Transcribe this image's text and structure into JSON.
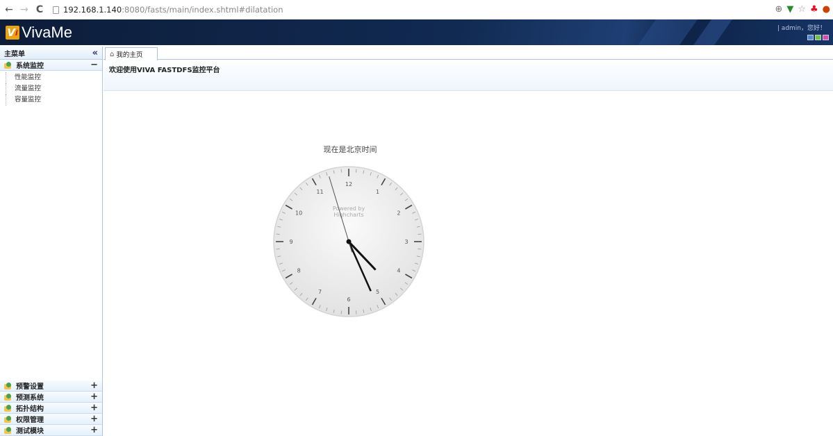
{
  "browser": {
    "url_host": "192.168.1.140",
    "url_path": ":8080/fasts/main/index.shtml#dilatation"
  },
  "header": {
    "logo_mark": "V",
    "logo_dot": "i",
    "app_name": "VivaMe",
    "user_info": "| admin，您好！",
    "theme_colors": [
      "#4a8cd8",
      "#6cc24a",
      "#d84ab8"
    ]
  },
  "sidebar": {
    "title": "主菜单",
    "collapse": "«",
    "groups": [
      {
        "label": "系统监控",
        "toggle": "−",
        "items": [
          "性能监控",
          "流量监控",
          "容量监控"
        ]
      },
      {
        "label": "预警设置",
        "toggle": "+"
      },
      {
        "label": "预测系统",
        "toggle": "+"
      },
      {
        "label": "拓扑结构",
        "toggle": "+"
      },
      {
        "label": "权限管理",
        "toggle": "+"
      },
      {
        "label": "测试模块",
        "toggle": "+"
      }
    ]
  },
  "main": {
    "tab_label": "我的主页",
    "welcome_text": "欢迎使用VIVA FASTDFS监控平台"
  },
  "clock": {
    "title": "现在是北京时间",
    "watermark": [
      "Powered by",
      "Highcharts"
    ],
    "hour": 4.55,
    "minute": 26,
    "second": 57.2
  },
  "colors": {
    "header_dark": "#0d1d3a",
    "border": "#a9c4e4"
  }
}
